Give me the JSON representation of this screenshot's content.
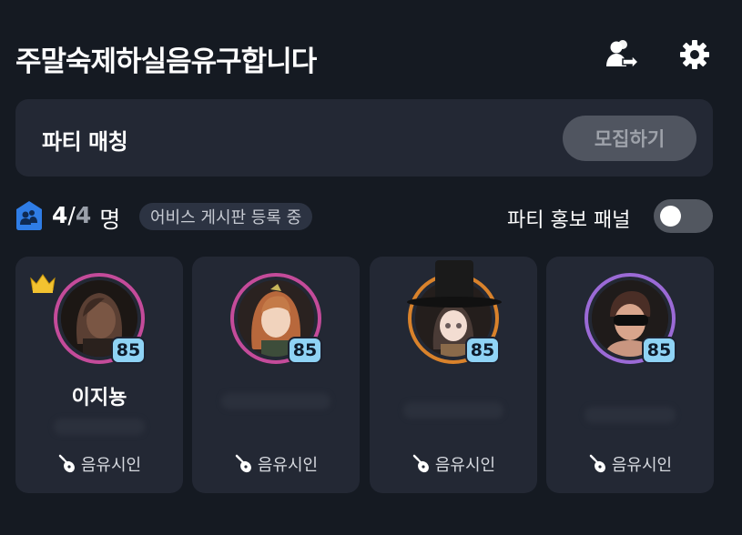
{
  "header": {
    "title": "주말숙제하실음유구합니다",
    "transfer_icon": "user-transfer-icon",
    "settings_icon": "gear-icon"
  },
  "match": {
    "label": "파티 매칭",
    "recruit_label": "모집하기"
  },
  "party_info": {
    "current": "4",
    "slash": "/",
    "max": "4",
    "unit": "명",
    "status_badge": "어비스 게시판 등록 중",
    "promo_label": "파티 홍보 패널",
    "promo_enabled": false
  },
  "members": [
    {
      "name": "이지뇽",
      "level": "85",
      "class": "음유시인",
      "leader": true,
      "ring_color": "#c44b9a"
    },
    {
      "name": "",
      "level": "85",
      "class": "음유시인",
      "leader": false,
      "ring_color": "#c44b9a"
    },
    {
      "name": "",
      "level": "85",
      "class": "음유시인",
      "leader": false,
      "ring_color": "#d9822b"
    },
    {
      "name": "",
      "level": "85",
      "class": "음유시인",
      "leader": false,
      "ring_color": "#9b6ad6"
    }
  ],
  "colors": {
    "background": "#151a22",
    "panel": "#232834",
    "level_badge": "#8fd3f5",
    "party_icon": "#2f7de6",
    "crown": "#f2c230"
  }
}
